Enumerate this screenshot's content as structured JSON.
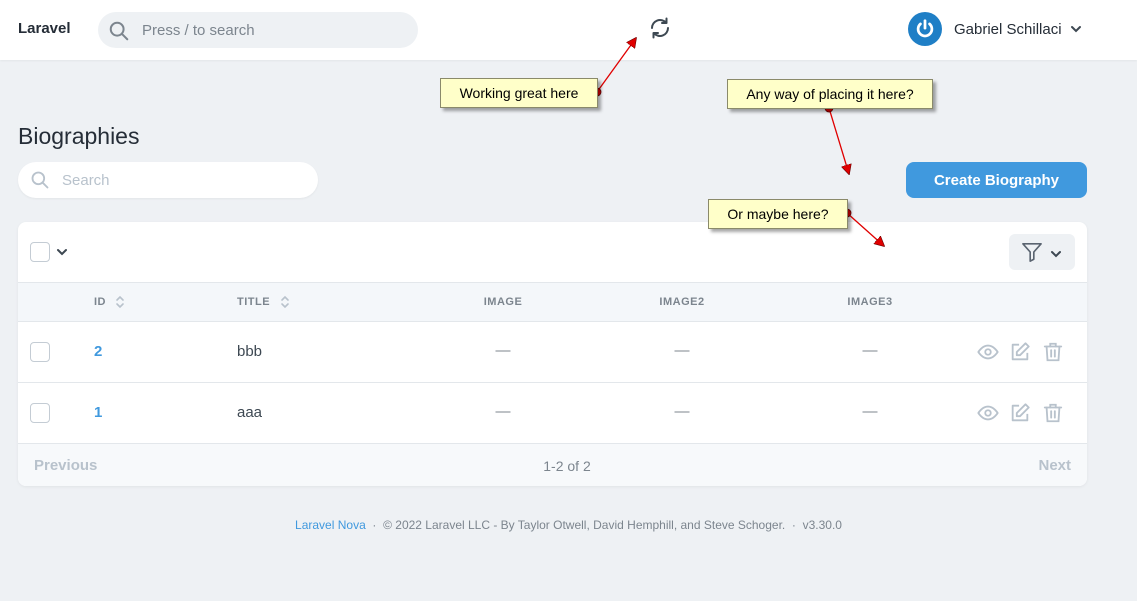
{
  "header": {
    "brand": "Laravel",
    "search_placeholder": "Press / to search",
    "user_name": "Gabriel Schillaci"
  },
  "page": {
    "title": "Biographies",
    "search_placeholder": "Search",
    "create_button_label": "Create Biography"
  },
  "table": {
    "columns": [
      "ID",
      "TITLE",
      "IMAGE",
      "IMAGE2",
      "IMAGE3"
    ],
    "rows": [
      {
        "id": "2",
        "title": "bbb",
        "image": "—",
        "image2": "—",
        "image3": "—"
      },
      {
        "id": "1",
        "title": "aaa",
        "image": "—",
        "image2": "—",
        "image3": "—"
      }
    ]
  },
  "pagination": {
    "previous": "Previous",
    "count": "1-2 of 2",
    "next": "Next"
  },
  "footer": {
    "link": "Laravel Nova",
    "sep1": "·",
    "copyright": "© 2022 Laravel LLC - By Taylor Otwell, David Hemphill, and Steve Schoger.",
    "sep2": "·",
    "version": "v3.30.0"
  },
  "annotations": {
    "callout_1": "Working great here",
    "callout_2": "Any way of placing it here?",
    "callout_3": "Or maybe here?"
  },
  "colors": {
    "accent": "#4099de",
    "page_background": "#eef1f4",
    "callout_fill": "#ffffc9",
    "arrow": "#e00000"
  },
  "icons": {
    "header_search": "search-icon",
    "refresh": "refresh-icon",
    "avatar": "power-icon",
    "view": "eye-icon",
    "edit": "edit-icon",
    "delete": "trash-icon",
    "filter": "filter-icon"
  }
}
